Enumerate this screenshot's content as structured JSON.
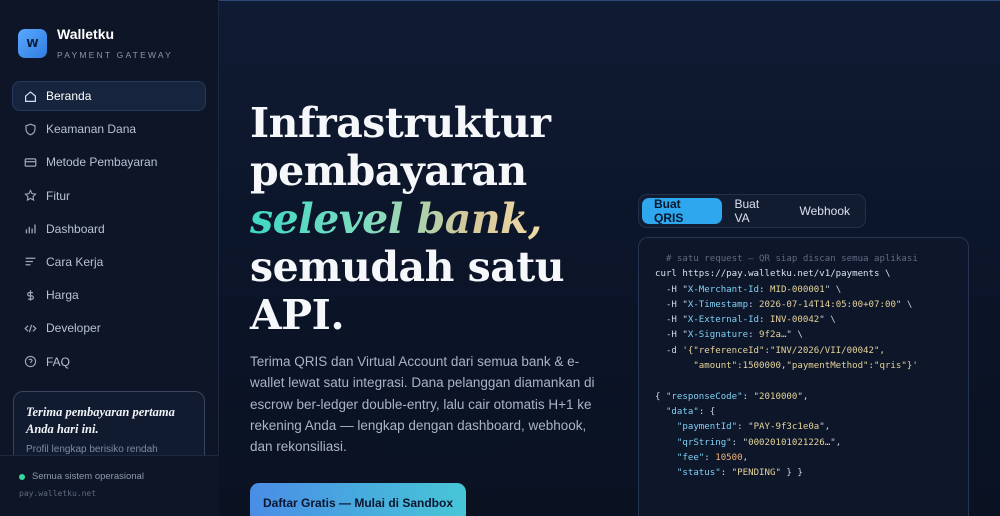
{
  "brand": {
    "logo_letter": "W",
    "name": "Walletku",
    "subtitle": "PAYMENT GATEWAY"
  },
  "nav": [
    {
      "label": "Beranda",
      "icon": "home-icon",
      "active": true
    },
    {
      "label": "Keamanan Dana",
      "icon": "shield-icon"
    },
    {
      "label": "Metode Pembayaran",
      "icon": "card-icon"
    },
    {
      "label": "Fitur",
      "icon": "star-icon"
    },
    {
      "label": "Dashboard",
      "icon": "bar-chart-icon"
    },
    {
      "label": "Cara Kerja",
      "icon": "lines-icon"
    },
    {
      "label": "Harga",
      "icon": "dollar-icon"
    },
    {
      "label": "Developer",
      "icon": "code-icon"
    },
    {
      "label": "FAQ",
      "icon": "help-circle-icon"
    }
  ],
  "promo": {
    "title": "Terima pembayaran pertama Anda hari ini.",
    "subtitle": "Profil lengkap berisiko rendah"
  },
  "footer": {
    "status": "Semua sistem operasional",
    "domain": "pay.walletku.net"
  },
  "hero": {
    "line1": "Infrastruktur",
    "line2": "pembayaran",
    "accent": "selevel bank,",
    "line4": "semudah satu",
    "line5": "API.",
    "description": "Terima QRIS dan Virtual Account dari semua bank & e-wallet lewat satu integrasi. Dana pelanggan diamankan di escrow ber-ledger double-entry, lalu cair otomatis H+1 ke rekening Anda — lengkap dengan dashboard, webhook, dan rekonsiliasi.",
    "cta": "Daftar Gratis — Mulai di Sandbox"
  },
  "tabs": [
    {
      "label": "Buat QRIS",
      "active": true
    },
    {
      "label": "Buat VA"
    },
    {
      "label": "Webhook"
    }
  ],
  "code": {
    "comment": "# satu request — QR siap discan semua aplikasi",
    "curl": "curl https://pay.walletku.net/v1/payments \\",
    "headers": [
      {
        "name": "X-Merchant-Id",
        "value": "MID-000001"
      },
      {
        "name": "X-Timestamp",
        "value": "2026-07-14T14:05:00+07:00"
      },
      {
        "name": "X-External-Id",
        "value": "INV-00042"
      },
      {
        "name": "X-Signature",
        "value": "9f2a…"
      }
    ],
    "body_line1": "'{\"referenceId\":\"INV/2026/VII/00042\",",
    "body_line2": "\"amount\":1500000,\"paymentMethod\":\"qris\"}'",
    "response": {
      "responseCode": "2010000",
      "paymentId": "PAY-9f3c1e0a",
      "qrString": "00020101021226…",
      "fee": "10500",
      "status": "PENDING"
    }
  },
  "colors": {
    "accent_blue": "#2ea7ee",
    "status_green": "#33d69f",
    "background": "#0b1120"
  }
}
